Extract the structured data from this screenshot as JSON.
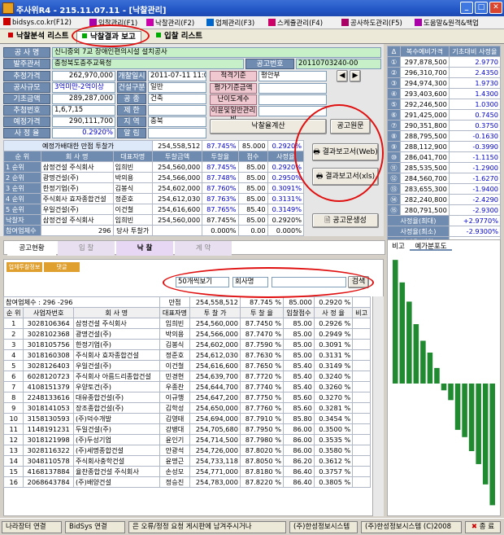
{
  "window": {
    "title": "주사위R4 - 215.11.07.11 - [낙찰관리]"
  },
  "menu": {
    "items": [
      "bidsys.co.kr(F12)",
      "입찰관리(F1)",
      "낙찰관리(F2)",
      "업체관리(F3)",
      "스케쥴관리(F4)",
      "공사하도관리(F5)",
      "도움말&원격&백업"
    ]
  },
  "tabs": [
    "낙찰분석 리스트",
    "낙찰결과 보고",
    "입찰 리스트"
  ],
  "form": {
    "labels": {
      "name": "공 사 명",
      "agency": "발주관서",
      "est_price": "추정가격",
      "scale": "공사규모",
      "base_amt": "기초금액",
      "seq": "추첨번호",
      "planned": "예정가격",
      "rate": "사 정 율",
      "bid_date": "개찰일시",
      "type": "건설구분",
      "kind": "공 종",
      "limit": "제 한",
      "region": "지 역",
      "alarm": "알 림",
      "notice_no": "공고번호",
      "method": "적격기준",
      "f1": "평가기준금액",
      "f2": "난이도계수",
      "f3": "이윤및일반관리비",
      "calc": "낙찰율계산"
    },
    "name": "신니중외 7교 장애인편의시설 설치공사",
    "agency": "충청북도충주교육청",
    "notice_no": "20110703240-00",
    "est_price": "262,970,000",
    "scale": "3억미만-2억이상",
    "base_amt": "289,287,000",
    "seq": "1,6,7,15",
    "planned": "290,111,700",
    "rate": "0.2920%",
    "bid_date": "2011-07-11 11:00",
    "type": "일반",
    "kind": "건축",
    "limit": "",
    "region": "충북",
    "alarm": "",
    "method": "평안부",
    "f1": "",
    "f2": "",
    "f3": ""
  },
  "mid": {
    "title": "예정가배대한 만점 투찰가",
    "title_amt": "254,558,512",
    "title_rate": "87.745%",
    "title_score": "85.000",
    "title_sr": "0.2920%",
    "headers": [
      "순 위",
      "회 사 명",
      "대표자명",
      "투찰금액",
      "투찰율",
      "점수",
      "사정율"
    ],
    "rows": [
      {
        "rank": "1 순위",
        "company": "삼정건설 주식회사",
        "ceo": "임희빈",
        "amt": "254,560,000",
        "rate": "87.745%",
        "score": "85.00",
        "sr": "0.2920%"
      },
      {
        "rank": "2 순위",
        "company": "광명건설(주)",
        "ceo": "박의용",
        "amt": "254,566,000",
        "rate": "87.748%",
        "score": "85.00",
        "sr": "0.2950%"
      },
      {
        "rank": "3 순위",
        "company": "한정기업(주)",
        "ceo": "김봉식",
        "amt": "254,602,000",
        "rate": "87.760%",
        "score": "85.00",
        "sr": "0.3091%"
      },
      {
        "rank": "4 순위",
        "company": "주식회사 효자종합건설",
        "ceo": "정준호",
        "amt": "254,612,030",
        "rate": "87.763%",
        "score": "85.00",
        "sr": "0.3131%"
      },
      {
        "rank": "5 순위",
        "company": "우일건설(주)",
        "ceo": "이건철",
        "amt": "254,616,600",
        "rate": "87.765%",
        "score": "85.40",
        "sr": "0.3149%"
      }
    ],
    "winner_label": "낙찰자",
    "winner": {
      "company": "삼정건설 주식회사",
      "ceo": "임희빈",
      "amt": "254,560,000",
      "rate": "87.745%",
      "score": "85.00",
      "sr": "0.2920%"
    },
    "count_label": "참여업체수",
    "count": "296",
    "diff_label": "당사 투찰가",
    "diff": {
      "amt": "",
      "rate": "0.000%",
      "score": "0.00",
      "sr": "0.000%"
    }
  },
  "buttons": {
    "notice": "공고원문",
    "web": "결과보고서(Web)",
    "xls": "결과보고서(xls)",
    "make": "공고문생성"
  },
  "right": {
    "headers": [
      "Δ",
      "복수예비가격",
      "기초대비 사정율"
    ],
    "rows": [
      {
        "n": "①",
        "price": "297,878,500",
        "r": "2.9770"
      },
      {
        "n": "②",
        "price": "296,310,700",
        "r": "2.4350"
      },
      {
        "n": "③",
        "price": "294,974,300",
        "r": "1.9730"
      },
      {
        "n": "④",
        "price": "293,403,600",
        "r": "1.4300"
      },
      {
        "n": "⑤",
        "price": "292,246,500",
        "r": "1.0300"
      },
      {
        "n": "⑥",
        "price": "291,425,000",
        "r": "0.7450"
      },
      {
        "n": "⑦",
        "price": "290,351,800",
        "r": "0.3750"
      },
      {
        "n": "⑧",
        "price": "288,795,500",
        "r": "-0.1630"
      },
      {
        "n": "⑨",
        "price": "288,112,900",
        "r": "-0.3990"
      },
      {
        "n": "⑩",
        "price": "286,041,700",
        "r": "-1.1150"
      },
      {
        "n": "⑪",
        "price": "285,535,500",
        "r": "-1.2900"
      },
      {
        "n": "⑫",
        "price": "284,560,700",
        "r": "-1.6270"
      },
      {
        "n": "⑬",
        "price": "283,655,300",
        "r": "-1.9400"
      },
      {
        "n": "⑭",
        "price": "282,240,800",
        "r": "-2.4290"
      },
      {
        "n": "⑮",
        "price": "280,791,500",
        "r": "-2.9300"
      }
    ],
    "max_label": "사정율(최대)",
    "max": "+2.9770%",
    "min_label": "사정율(최소)",
    "min": "-2.9300%",
    "range_label": "사정율(범위)",
    "range": "+5.9070%",
    "chart_tabs": [
      "비고",
      "예가분포도"
    ]
  },
  "progress": {
    "steps": [
      "공고현황",
      "입 찰",
      "낙 찰",
      "계 약"
    ]
  },
  "lower": {
    "subtabs": [
      "업체투찰정보",
      "댓글"
    ],
    "filter_view": "50개씩보기",
    "filter_field": "회사명",
    "search_btn": "검색",
    "summary": "참여업체수 : 296 -296",
    "summary_tag": "만점",
    "summary_amt": "254,558,512",
    "summary_rate": "87.745 %",
    "summary_score": "85.000",
    "summary_sr": "0.2920 %",
    "headers": [
      "순 위",
      "사업자번호",
      "회 사 명",
      "대표자명",
      "투 찰 가",
      "투 찰 율",
      "입찰점수",
      "사 정 율",
      "비고"
    ],
    "rows": [
      [
        "1",
        "3028106364",
        "삼정건설 주식회사",
        "임희빈",
        "254,560,000",
        "87.7450 %",
        "85.00",
        "0.2926 %",
        ""
      ],
      [
        "2",
        "3028102368",
        "광명건설(주)",
        "박의용",
        "254,566,000",
        "87.7470 %",
        "85.00",
        "0.2949 %",
        ""
      ],
      [
        "3",
        "3018105756",
        "한정기업(주)",
        "김봉식",
        "254,602,000",
        "87.7590 %",
        "85.00",
        "0.3091 %",
        ""
      ],
      [
        "4",
        "3018160308",
        "주식회사 효자종합건설",
        "정준호",
        "254,612,030",
        "87.7630 %",
        "85.00",
        "0.3131 %",
        ""
      ],
      [
        "5",
        "3028126403",
        "우일건설(주)",
        "이건철",
        "254,616,600",
        "87.7650 %",
        "85.40",
        "0.3149 %",
        ""
      ],
      [
        "6",
        "6028120723",
        "주식회사 아름드리종합건설",
        "민경현",
        "254,639,700",
        "87.7720 %",
        "85.40",
        "0.3240 %",
        ""
      ],
      [
        "7",
        "4108151379",
        "우양토건(주)",
        "우종찬",
        "254,644,700",
        "87.7740 %",
        "85.40",
        "0.3260 %",
        ""
      ],
      [
        "8",
        "2248133616",
        "대유종합건설(주)",
        "이규행",
        "254,647,200",
        "87.7750 %",
        "85.60",
        "0.3270 %",
        ""
      ],
      [
        "9",
        "3018141053",
        "장조종합건설(주)",
        "김학성",
        "254,650,000",
        "87.7760 %",
        "85.60",
        "0.3281 %",
        ""
      ],
      [
        "10",
        "3158130593",
        "(주)덕수개발",
        "김영태",
        "254,694,000",
        "87.7910 %",
        "85.80",
        "0.3454 %",
        ""
      ],
      [
        "11",
        "1148191231",
        "두일건설(주)",
        "강병대",
        "254,705,680",
        "87.7950 %",
        "86.00",
        "0.3500 %",
        ""
      ],
      [
        "12",
        "3018121998",
        "(주)두성기업",
        "윤인기",
        "254,714,500",
        "87.7980 %",
        "86.00",
        "0.3535 %",
        ""
      ],
      [
        "13",
        "3028116322",
        "(주)세명종합건설",
        "안광석",
        "254,726,000",
        "87.8020 %",
        "86.00",
        "0.3580 %",
        ""
      ],
      [
        "14",
        "3048110578",
        "주식회사충학건설",
        "윤명근",
        "254,733,118",
        "87.8050 %",
        "86.20",
        "0.3612 %",
        ""
      ],
      [
        "15",
        "4168137884",
        "율찬종합건설 주식회사",
        "손성모",
        "254,771,000",
        "87.8180 %",
        "86.40",
        "0.3757 %",
        ""
      ],
      [
        "16",
        "2068643784",
        "(주)배양건설",
        "정승진",
        "254,783,000",
        "87.8220 %",
        "86.40",
        "0.3805 %",
        ""
      ]
    ]
  },
  "status": {
    "b1": "나라장터 연결",
    "b2": "BidSys 연결",
    "msg": "은 오류/정정 요청 게시판에 남겨주시거나",
    "company": "(주)한성정보시스템",
    "copy": "(주)한성정보시스템 (C)2008",
    "close": "종 료"
  },
  "chart_data": {
    "type": "bar",
    "categories": [
      "1",
      "2",
      "3",
      "4",
      "5",
      "6",
      "7",
      "8",
      "9",
      "10",
      "11",
      "12",
      "13",
      "14",
      "15"
    ],
    "values": [
      2.977,
      2.435,
      1.973,
      1.43,
      1.03,
      0.745,
      0.375,
      -0.163,
      -0.399,
      -1.115,
      -1.29,
      -1.627,
      -1.94,
      -2.429,
      -2.93
    ],
    "title": "",
    "xlabel": "",
    "ylabel": ""
  }
}
